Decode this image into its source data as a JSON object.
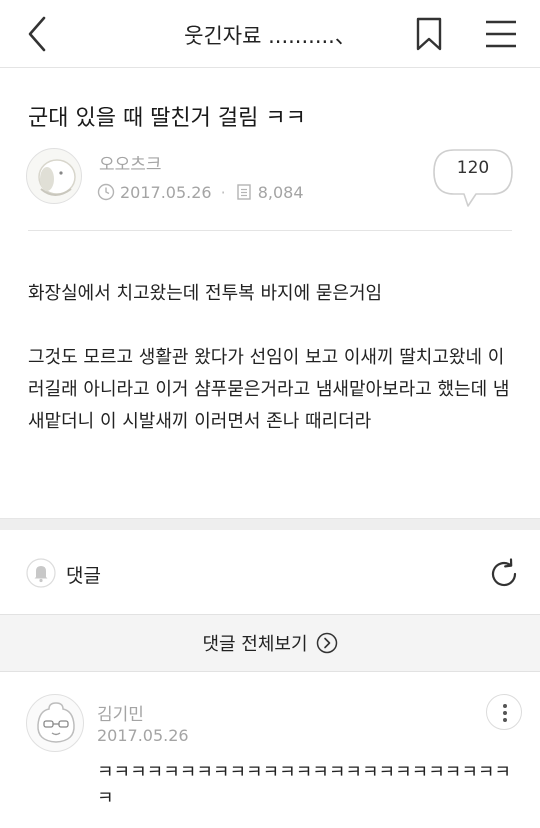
{
  "header": {
    "title": "웃긴자료 ..........、",
    "back_icon": "chevron-left-icon",
    "bookmark_icon": "bookmark-icon",
    "menu_icon": "hamburger-menu-icon"
  },
  "post": {
    "title": "군대 있을 때 딸친거 걸림 ㅋㅋ",
    "author": "오오츠크",
    "date": "2017.05.26",
    "views": "8,084",
    "comment_count": "120",
    "body": [
      "화장실에서 치고왔는데 전투복 바지에 묻은거임",
      "그것도 모르고 생활관 왔다가 선임이 보고 이새끼 딸치고왔네 이러길래 아니라고 이거 샴푸묻은거라고 냄새맡아보라고 했는데 냄새맡더니 이 시발새끼 이러면서 존나 때리더라"
    ]
  },
  "comments": {
    "label": "댓글",
    "view_all": "댓글 전체보기",
    "items": [
      {
        "author": "김기민",
        "date": "2017.05.26",
        "text": "ㅋㅋㅋㅋㅋㅋㅋㅋㅋㅋㅋㅋㅋㅋㅋㅋㅋㅋㅋㅋㅋㅋㅋㅋㅋㅋ"
      }
    ]
  }
}
